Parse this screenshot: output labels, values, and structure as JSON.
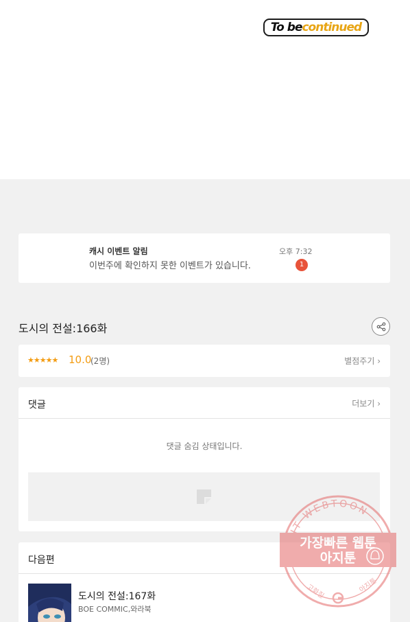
{
  "header": {
    "tbc_part1": "To be ",
    "tbc_part2": "continued"
  },
  "notification": {
    "title": "캐시 이벤트 알림",
    "message": "이번주에 확인하지 못한 이벤트가 있습니다.",
    "time": "오후 7:32",
    "badge_count": "1"
  },
  "episode": {
    "title": "도시의 전설:166화",
    "share_icon": "share-icon"
  },
  "rating": {
    "stars": "★★★★★",
    "score": "10.0",
    "count": "(2명)",
    "rate_label": "별점주기 ›"
  },
  "comments": {
    "title": "댓글",
    "more_label": "더보기 ›",
    "hidden_message": "댓글 숨김 상태입니다."
  },
  "next_episode": {
    "section_title": "다음편",
    "title": "도시의 전설:167화",
    "author": "BOE COMMIC,와라북"
  },
  "watermark": {
    "ring_text": "AGIT WEBTOON",
    "line1": "가장빠른 웹툰",
    "line2": "아지툰",
    "bottom_left": "고화질",
    "bottom_right": "아지툰",
    "color": "#e46a6a"
  },
  "colors": {
    "accent": "#f39c12",
    "badge": "#e8533a",
    "background": "#f1f1f1"
  }
}
